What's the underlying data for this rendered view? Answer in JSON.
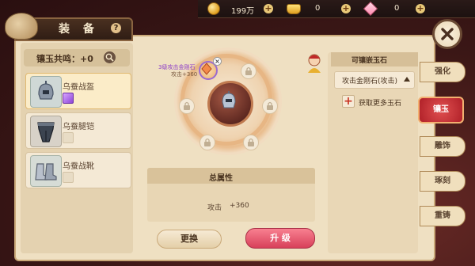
{
  "currency": {
    "coins": "199万",
    "ingots": "0",
    "gems": "0",
    "plus": "+"
  },
  "panel": {
    "title": "装 备",
    "help": "?"
  },
  "resonance": {
    "label": "镶玉共鸣：+0"
  },
  "equipment": [
    {
      "name": "乌蚕战盔",
      "selected": true,
      "slot": "purple"
    },
    {
      "name": "乌蚕腿铠",
      "selected": false,
      "slot": "empty"
    },
    {
      "name": "乌蚕战靴",
      "selected": false,
      "slot": "empty"
    }
  ],
  "socket": {
    "gem_name": "3级攻击金刚石",
    "gem_bonus": "攻击+360",
    "remove": "×"
  },
  "attributes": {
    "title": "总属性",
    "rows": [
      {
        "name": "攻击",
        "value": "+360"
      }
    ]
  },
  "buttons": {
    "swap": "更换",
    "upgrade": "升 级"
  },
  "gem_panel": {
    "title": "可镶嵌玉石",
    "selected_gem": "攻击金刚石(攻击)",
    "get_more": "获取更多玉石"
  },
  "tabs": [
    {
      "label": "强化",
      "active": false
    },
    {
      "label": "镶玉",
      "active": true
    },
    {
      "label": "雕饰",
      "active": false
    },
    {
      "label": "琢刻",
      "active": false
    },
    {
      "label": "重铸",
      "active": false
    }
  ],
  "colors": {
    "accent": "#d8405a",
    "active_tab": "#b02028",
    "gem_text": "#8c3ec8"
  }
}
